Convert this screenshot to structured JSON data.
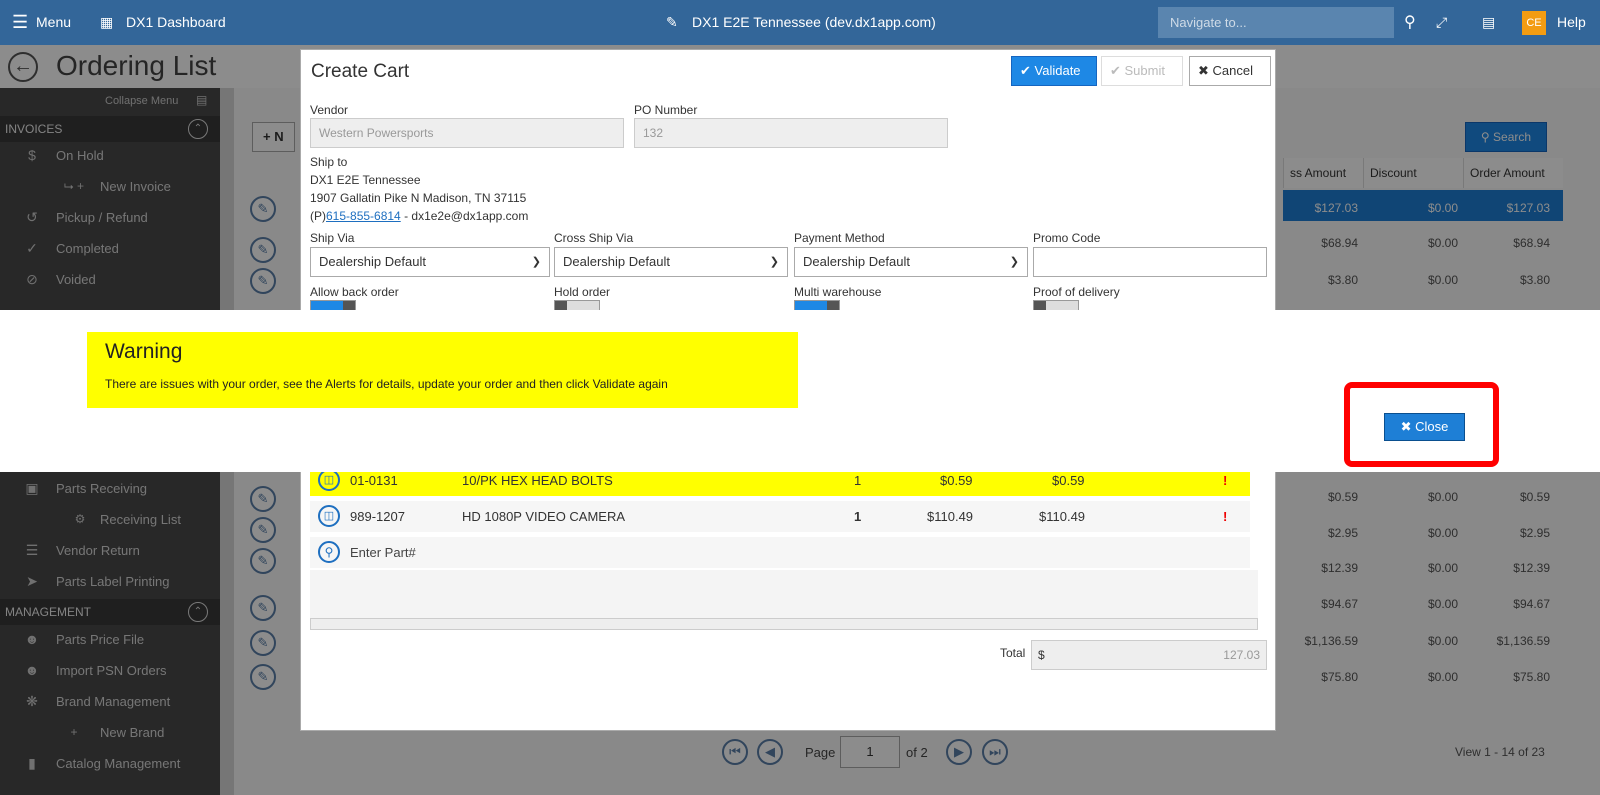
{
  "topbar": {
    "menu_label": "Menu",
    "dashboard_label": "DX1 Dashboard",
    "site_title": "DX1 E2E Tennessee (dev.dx1app.com)",
    "navigate_placeholder": "Navigate to...",
    "user_initials": "CE",
    "help_label": "Help"
  },
  "page": {
    "title": "Ordering List"
  },
  "sidebar": {
    "collapse_label": "Collapse Menu",
    "section_invoices": "INVOICES",
    "invoices": [
      {
        "label": "On Hold",
        "icon": "dollar-icon"
      },
      {
        "label": "New Invoice",
        "icon": "plus-icon"
      },
      {
        "label": "Pickup / Refund",
        "icon": "refund-icon"
      },
      {
        "label": "Completed",
        "icon": "check-icon"
      },
      {
        "label": "Voided",
        "icon": "void-icon"
      }
    ],
    "parts": [
      {
        "label": "Parts Receiving",
        "icon": "receiving-icon"
      },
      {
        "label": "Receiving List",
        "icon": "gear-icon"
      },
      {
        "label": "Vendor Return",
        "icon": "list-icon"
      },
      {
        "label": "Parts Label Printing",
        "icon": "label-icon"
      }
    ],
    "section_management": "MANAGEMENT",
    "management": [
      {
        "label": "Parts Price File",
        "icon": "users-icon"
      },
      {
        "label": "Import PSN Orders",
        "icon": "users-icon"
      },
      {
        "label": "Brand Management",
        "icon": "brand-icon"
      },
      {
        "label": "New Brand",
        "icon": "plus-icon"
      },
      {
        "label": "Catalog Management",
        "icon": "book-icon"
      }
    ]
  },
  "background": {
    "new_button_label": "+ N",
    "search_button": "Search",
    "headers": [
      "ss Amount",
      "Discount",
      "Order Amount"
    ],
    "rows_top": [
      [
        "$127.03",
        "$0.00",
        "$127.03"
      ],
      [
        "$68.94",
        "$0.00",
        "$68.94"
      ],
      [
        "$3.80",
        "$0.00",
        "$3.80"
      ]
    ],
    "rows_bottom": [
      [
        "$0.59",
        "$0.00",
        "$0.59"
      ],
      [
        "$2.95",
        "$0.00",
        "$2.95"
      ],
      [
        "$12.39",
        "$0.00",
        "$12.39"
      ],
      [
        "$94.67",
        "$0.00",
        "$94.67"
      ],
      [
        "$1,136.59",
        "$0.00",
        "$1,136.59"
      ],
      [
        "$75.80",
        "$0.00",
        "$75.80"
      ]
    ],
    "pager_label": "Page",
    "pager_value": "1",
    "pager_total": "of 2",
    "view_range": "View 1 - 14 of 23"
  },
  "modal": {
    "title": "Create Cart",
    "validate_label": "Validate",
    "submit_label": "Submit",
    "cancel_label": "Cancel",
    "vendor_label": "Vendor",
    "vendor_value": "Western Powersports",
    "po_label": "PO Number",
    "po_value": "132",
    "ship_to_label": "Ship to",
    "ship_to_name": "DX1 E2E Tennessee",
    "ship_to_address": "1907 Gallatin Pike N Madison, TN 37115",
    "phone_prefix": "(P)",
    "phone": "615-855-6814",
    "email_sep": " - dx1e2e@dx1app.com",
    "ship_via_label": "Ship Via",
    "ship_via_value": "Dealership Default",
    "cross_ship_label": "Cross Ship Via",
    "cross_ship_value": "Dealership Default",
    "payment_label": "Payment Method",
    "payment_value": "Dealership Default",
    "promo_label": "Promo Code",
    "promo_value": "",
    "allow_back_label": "Allow back order",
    "hold_label": "Hold order",
    "multi_wh_label": "Multi warehouse",
    "pod_label": "Proof of delivery",
    "parts": [
      {
        "part": "01-0131",
        "desc": "10/PK HEX HEAD BOLTS",
        "qty": "1",
        "price": "$0.59",
        "ext": "$0.59",
        "alert": "!"
      },
      {
        "part": "989-1207",
        "desc": "HD 1080P VIDEO CAMERA",
        "qty": "1",
        "price": "$110.49",
        "ext": "$110.49",
        "alert": "!"
      }
    ],
    "enter_part_placeholder": "Enter Part#",
    "total_label": "Total",
    "total_currency": "$",
    "total_value": "127.03"
  },
  "warning": {
    "title": "Warning",
    "message": "There are issues with your order, see the Alerts for details, update your order and then click Validate again",
    "close_label": "Close"
  },
  "colors": {
    "topbar": "#336699",
    "warning_bg": "#ffff00",
    "highlight_ring": "#ff0000",
    "close_button": "#1e7fd6"
  }
}
